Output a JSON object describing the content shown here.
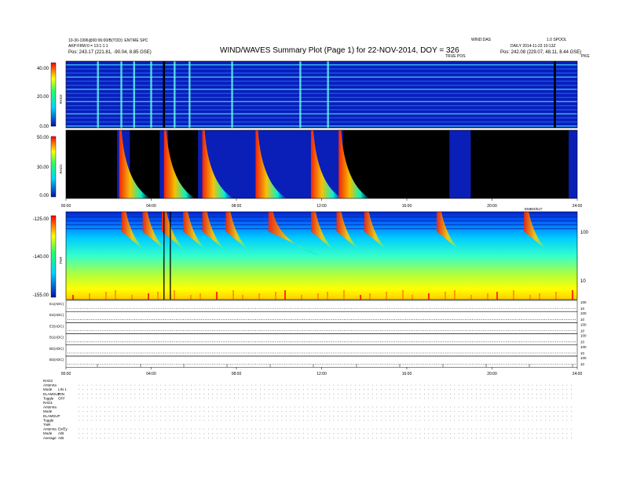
{
  "header": {
    "title": "WIND/WAVES Summary Plot (Page 1) for 22-NOV-2014, DOY = 326",
    "left_line1": "10-30-1996@00:06:00/B(TOD): ENTIRE SPC",
    "left_line2": "AKP:FRW:0 = 13:1:1:1",
    "left_pos": "Pos:   243.17 (221.81, -90.04, 8.85 GSE)",
    "center_label": "WIND:DAS",
    "right_label": "1.0 SPOOL",
    "right_line2": "DAILY  2014-11-23 10:13Z",
    "right_pos": "Pos:   242.08 (229.07, 48.11, 8.44 GSE)",
    "tag_truepos": "TRUE POS",
    "tag_pkg": "PKG"
  },
  "chart_data": [
    {
      "type": "heatmap",
      "name": "RAD2",
      "ylabel": "RAD2",
      "yticks": [
        "40.00",
        "20.00",
        "0.00"
      ],
      "ylim": [
        0,
        40
      ],
      "xlim": [
        0,
        24
      ],
      "bursts": [
        1.5,
        2.6,
        3.2,
        4.0,
        4.6,
        5.1,
        5.8,
        7.8,
        11.0,
        12.3
      ],
      "dropouts": [
        [
          4.55,
          4.65
        ],
        [
          22.9,
          23.0
        ]
      ]
    },
    {
      "type": "heatmap",
      "name": "RAD1",
      "ylabel": "RAD1",
      "yticks": [
        "50.00",
        "30.00",
        "0.00"
      ],
      "ylim": [
        0,
        50
      ],
      "xlim": [
        0,
        24
      ],
      "xticks": [
        "00:00",
        "04:00",
        "08:00",
        "12:00",
        "16:00",
        "20:00",
        "24:00"
      ],
      "bursts": [
        2.5,
        4.6,
        6.4,
        8.9,
        11.5,
        12.8
      ],
      "gaps": [
        [
          0,
          2.4
        ],
        [
          3.0,
          4.4
        ],
        [
          4.8,
          6.2
        ],
        [
          13.0,
          18.0
        ],
        [
          19.0,
          23.6
        ]
      ]
    },
    {
      "type": "heatmap",
      "name": "TNR",
      "ylabel": "TNR",
      "yticks": [
        "-125.00",
        "-140.00",
        "-155.00"
      ],
      "ylim": [
        -155,
        -125
      ],
      "right_ticks": [
        "100",
        "10"
      ],
      "xlim": [
        0,
        24
      ],
      "bursts": [
        2.6,
        3.6,
        4.5,
        5.5,
        6.4,
        7.5,
        9.5,
        11.5,
        12.7,
        14.0,
        17.4,
        21.5
      ],
      "vlines": [
        4.6,
        4.9
      ],
      "label_top": "EMBO/ELT"
    },
    {
      "type": "line",
      "name": "channels",
      "rows": [
        {
          "label": "E1(ADC)",
          "scale": [
            "100",
            "10"
          ]
        },
        {
          "label": "E2(ADC)",
          "scale": [
            "100",
            "10"
          ]
        },
        {
          "label": "E3(ADC)",
          "scale": [
            "100",
            "10"
          ]
        },
        {
          "label": "B1(ADC)",
          "scale": [
            "100",
            "10"
          ]
        },
        {
          "label": "B2(ADC)",
          "scale": [
            "100",
            "10"
          ]
        },
        {
          "label": "B3(ADC)",
          "scale": [
            "100",
            "10"
          ]
        }
      ],
      "xticks": [
        "00:00",
        "04:00",
        "08:00",
        "12:00",
        "16:00",
        "20:00",
        "24:00"
      ],
      "xlim": [
        0,
        24
      ]
    }
  ],
  "settings": {
    "groups": [
      {
        "name": "RAD2",
        "rows": [
          {
            "k": "Antenna",
            "v": ""
          },
          {
            "k": "Mode",
            "v": "LIN 1"
          },
          {
            "k": "ELAMSUP",
            "v": "ION"
          },
          {
            "k": "Toggle",
            "v": "OFF"
          }
        ]
      },
      {
        "name": "RAD1",
        "rows": [
          {
            "k": "Antenna",
            "v": ""
          },
          {
            "k": "Mode",
            "v": ""
          },
          {
            "k": "ELAMSUP",
            "v": ""
          },
          {
            "k": "Toggle",
            "v": ""
          }
        ]
      },
      {
        "name": "TNR",
        "rows": [
          {
            "k": "Antenna",
            "v": "Ex/Ey"
          },
          {
            "k": "Mode",
            "v": "A/B"
          },
          {
            "k": "Average",
            "v": "A/B"
          }
        ]
      }
    ]
  },
  "colors": {
    "low": "#0011aa",
    "mid": "#00d4ff",
    "high": "#ffff00",
    "peak": "#ff0000"
  }
}
